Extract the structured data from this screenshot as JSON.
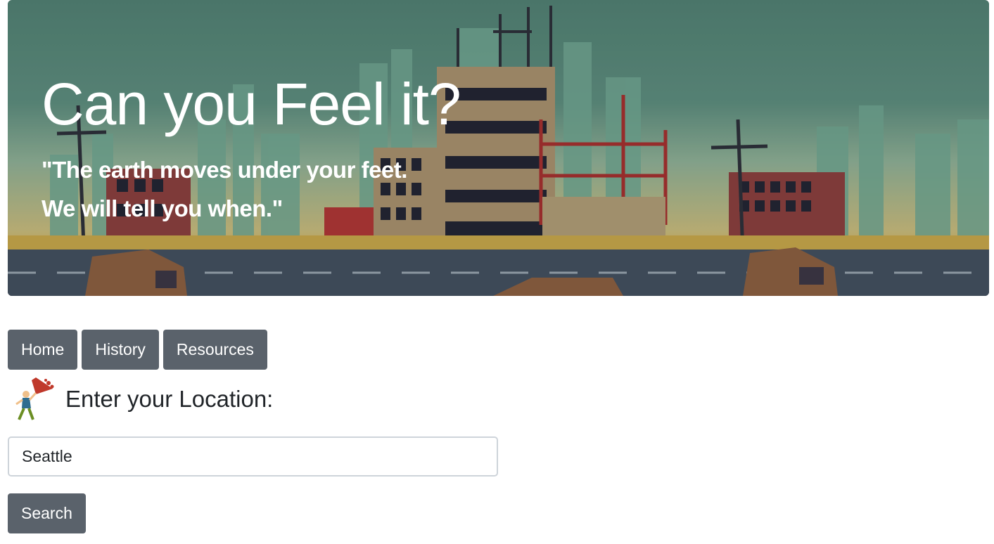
{
  "hero": {
    "title": "Can you Feel it?",
    "quote_line1": "\"The earth moves under your feet.",
    "quote_line2": "We will tell you when.\""
  },
  "nav": {
    "items": [
      {
        "label": "Home"
      },
      {
        "label": "History"
      },
      {
        "label": "Resources"
      }
    ]
  },
  "location": {
    "label": "Enter your Location:",
    "icon": "falling-debris-person-icon",
    "input_value": "Seattle"
  },
  "search": {
    "label": "Search"
  },
  "colors": {
    "button_bg": "#5a626b",
    "hero_sky": "#4f7d70",
    "text": "#212529"
  }
}
